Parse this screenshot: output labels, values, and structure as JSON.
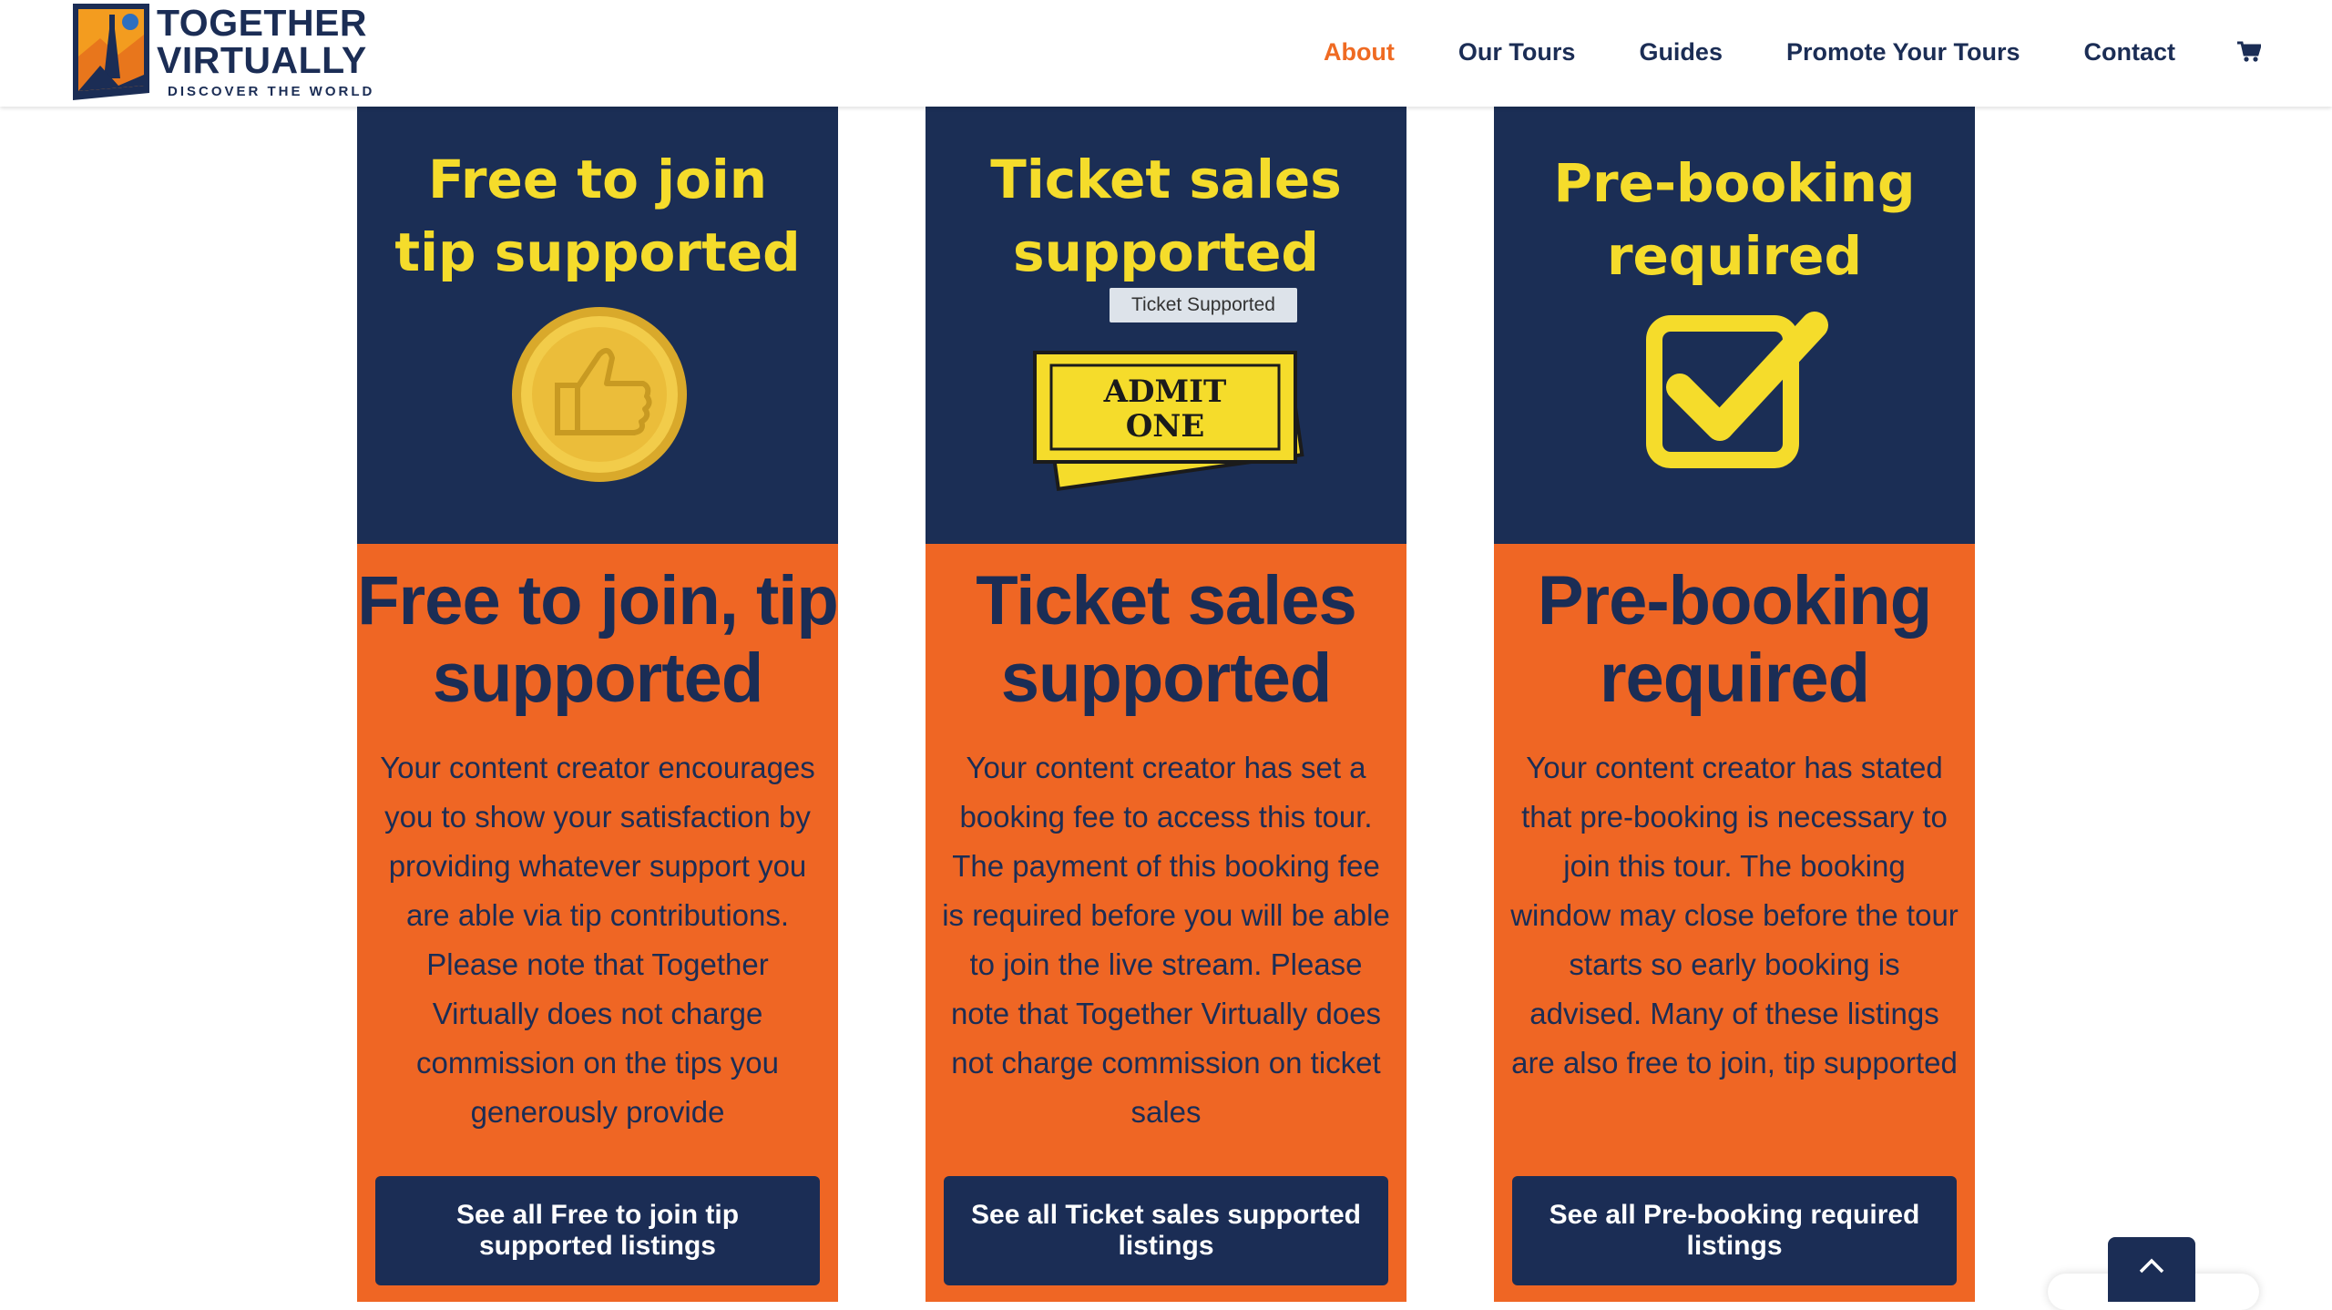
{
  "header": {
    "logo": {
      "line1": "TOGETHER",
      "line2": "VIRTUALLY",
      "tagline": "DISCOVER THE WORLD"
    },
    "nav": [
      {
        "label": "About",
        "active": true
      },
      {
        "label": "Our Tours",
        "active": false
      },
      {
        "label": "Guides",
        "active": false
      },
      {
        "label": "Promote Your Tours",
        "active": false
      },
      {
        "label": "Contact",
        "active": false
      }
    ],
    "cart_icon": "cart-icon"
  },
  "colors": {
    "navy": "#1b2d55",
    "orange": "#ef6624",
    "yellow": "#f5dc2b",
    "active_nav": "#ef6a22"
  },
  "cards": [
    {
      "media_text": "Free to join\ntip supported",
      "media_icon": "thumbs-up-coin-icon",
      "title": "Free to join, tip supported",
      "description": "Your content creator encourages you to show your satisfaction by providing whatever support you are able via tip contributions. Please note that Together Virtually does not charge commission on the tips you generously provide",
      "button": "See all Free to join tip supported listings"
    },
    {
      "media_text": "Ticket sales\nsupported",
      "media_icon": "admit-one-ticket-icon",
      "ticket_text": "ADMIT\nONE",
      "tooltip": "Ticket Supported",
      "title": "Ticket sales supported",
      "description": "Your content creator has set a booking fee to access this tour. The payment of this booking fee is required before you will be able to join the live stream. Please note that Together Virtually does not charge commission on ticket sales",
      "button": "See all Ticket sales supported listings"
    },
    {
      "media_text": "Pre-booking\nrequired",
      "media_icon": "checkbox-icon",
      "title": "Pre-booking required",
      "description": "Your content creator has stated that pre-booking is necessary to join this tour. The booking window may close before the tour starts so early booking is advised. Many of these listings are also free to join, tip supported",
      "button": "See all Pre-booking required listings"
    }
  ],
  "scroll_to_top_icon": "chevron-up-icon"
}
